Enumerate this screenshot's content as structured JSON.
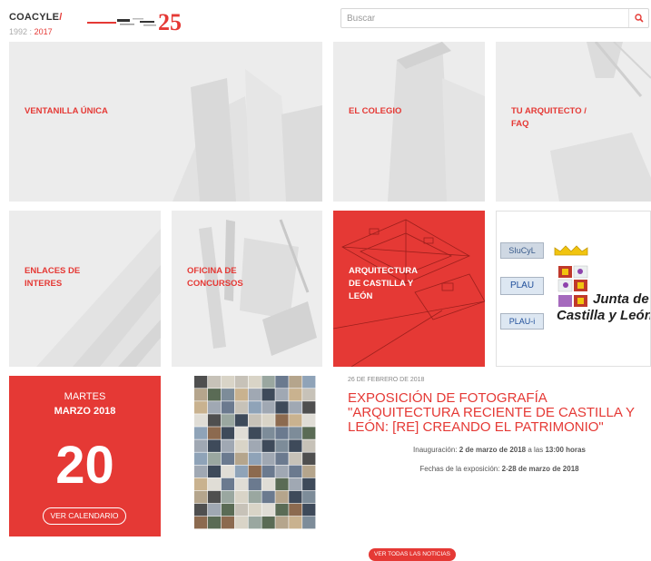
{
  "header": {
    "brand_name": "COACYLE",
    "brand_slash": "/",
    "year_start": "1992",
    "year_sep": ":",
    "year_end": "2017",
    "anniversary_logo_text": "25",
    "search_placeholder": "Buscar",
    "search_icon": "search-icon"
  },
  "tiles": {
    "ventanilla": "VENTANILLA ÚNICA",
    "colegio": "EL COLEGIO",
    "faq_1": "TU ARQUITECTO /",
    "faq_2": "FAQ",
    "enlaces_1": "ENLACES DE",
    "enlaces_2": "INTERES",
    "concursos_1": "OFICINA DE",
    "concursos_2": "CONCURSOS",
    "arq_1": "ARQUITECTURA",
    "arq_2": "DE CASTILLA Y",
    "arq_3": "LEÓN",
    "partners": {
      "siucyl": "SIuCyL",
      "plau": "PLAU",
      "plaui": "PLAU-i",
      "junta_1": "Junta de",
      "junta_2": "Castilla y León"
    }
  },
  "calendar": {
    "weekday": "MARTES",
    "month_year": "MARZO 2018",
    "day": "20",
    "button": "VER CALENDARIO"
  },
  "news": {
    "date": "26 DE FEBRERO DE 2018",
    "title": "EXPOSICIÓN DE FOTOGRAFÍA \"ARQUITECTURA RECIENTE DE CASTILLA Y LEÓN: [RE] CREANDO EL PATRIMONIO\"",
    "p1_prefix": "Inauguración: ",
    "p1_bold": "2 de marzo de 2018",
    "p1_mid": " a las ",
    "p1_bold2": "13:00 horas",
    "p2_prefix": "Fechas de la exposición: ",
    "p2_bold": "2-28 de marzo de 2018",
    "all_button": "VER TODAS LAS NOTICIAS"
  },
  "colors": {
    "accent": "#e53935",
    "tile_grey": "#ececec"
  }
}
